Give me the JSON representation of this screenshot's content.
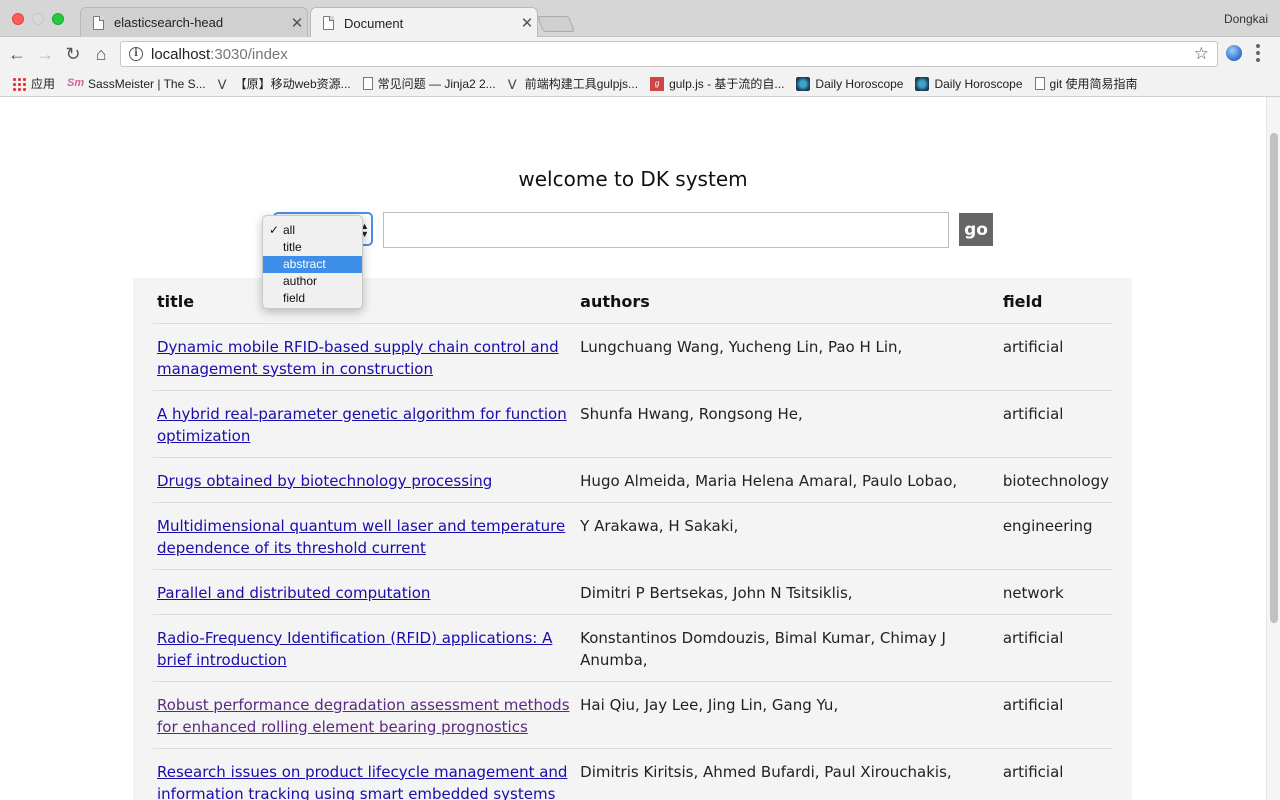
{
  "browser": {
    "tabs": [
      {
        "title": "elasticsearch-head",
        "close": "✕"
      },
      {
        "title": "Document",
        "close": "✕"
      }
    ],
    "user": "Dongkai",
    "url_host": "localhost",
    "url_path": ":3030/index",
    "bookmarks": [
      {
        "label": "应用",
        "icon": "apps-grid-icon"
      },
      {
        "label": "SassMeister | The S...",
        "icon": "sassmeister-icon"
      },
      {
        "label": "【原】移动web资源...",
        "icon": "v-logo-icon"
      },
      {
        "label": "常见问题 — Jinja2 2...",
        "icon": "page-icon"
      },
      {
        "label": "前端构建工具gulpjs...",
        "icon": "v-logo-icon"
      },
      {
        "label": "gulp.js - 基于流的自...",
        "icon": "gulp-icon"
      },
      {
        "label": "Daily Horoscope",
        "icon": "horoscope-icon"
      },
      {
        "label": "Daily Horoscope",
        "icon": "horoscope-icon"
      },
      {
        "label": "git 使用简易指南",
        "icon": "page-icon"
      }
    ]
  },
  "page": {
    "heading": "welcome to DK system",
    "search": {
      "value": "",
      "go_label": "go",
      "filter_options": [
        "all",
        "title",
        "abstract",
        "author",
        "field"
      ],
      "checked_option": "all",
      "highlighted_option": "abstract"
    },
    "table": {
      "headers": [
        "title",
        "authors",
        "field"
      ],
      "rows": [
        {
          "title": "Dynamic mobile RFID-based supply chain control and management system in construction",
          "authors": "Lungchuang Wang, Yucheng Lin, Pao H Lin,",
          "field": "artificial"
        },
        {
          "title": "A hybrid real-parameter genetic algorithm for function optimization",
          "authors": "Shunfa Hwang, Rongsong He,",
          "field": "artificial"
        },
        {
          "title": "Drugs obtained by biotechnology processing",
          "authors": "Hugo Almeida, Maria Helena Amaral, Paulo Lobao,",
          "field": "biotechnology"
        },
        {
          "title": "Multidimensional quantum well laser and temperature dependence of its threshold current",
          "authors": "Y Arakawa, H Sakaki,",
          "field": "engineering"
        },
        {
          "title": "Parallel and distributed computation",
          "authors": "Dimitri P Bertsekas, John N Tsitsiklis,",
          "field": "network"
        },
        {
          "title": "Radio-Frequency Identification (RFID) applications: A brief introduction",
          "authors": "Konstantinos Domdouzis, Bimal Kumar, Chimay J Anumba,",
          "field": "artificial"
        },
        {
          "title": "Robust performance degradation assessment methods for enhanced rolling element bearing prognostics",
          "authors": "Hai Qiu, Jay Lee, Jing Lin, Gang Yu,",
          "field": "artificial"
        },
        {
          "title": "Research issues on product lifecycle management and information tracking using smart embedded systems",
          "authors": "Dimitris Kiritsis, Ahmed Bufardi, Paul Xirouchakis,",
          "field": "artificial"
        }
      ]
    }
  },
  "colors": {
    "link": "#1a0dab",
    "visited_link": "#5a2a82",
    "go_button": "#666666",
    "highlight": "#3d8ee8"
  }
}
